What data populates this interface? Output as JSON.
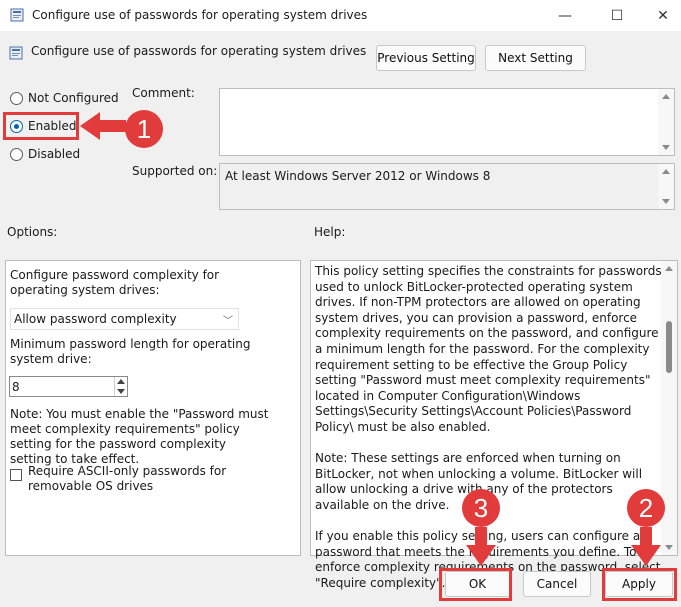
{
  "window": {
    "title": "Configure use of passwords for operating system drives",
    "controls": {
      "minimize": "—",
      "maximize": "☐",
      "close": "✕"
    }
  },
  "header": {
    "policy_title": "Configure use of passwords for operating system drives",
    "previous_label": "Previous Setting",
    "next_label": "Next Setting"
  },
  "state": {
    "options": [
      "Not Configured",
      "Enabled",
      "Disabled"
    ],
    "selected": "Enabled"
  },
  "comment": {
    "label": "Comment:",
    "value": ""
  },
  "supported": {
    "label": "Supported on:",
    "value": "At least Windows Server 2012 or Windows 8"
  },
  "options_section": {
    "label": "Options:",
    "complexity_label": "Configure password complexity for operating system  drives:",
    "complexity_value": "Allow password complexity",
    "min_length_label": "Minimum password length for operating system drive:",
    "min_length_value": "8",
    "note": "Note: You must enable the \"Password must meet complexity requirements\" policy setting for the password complexity setting to take effect.",
    "ascii_checkbox_label": "Require ASCII-only passwords for removable OS drives",
    "ascii_checked": false
  },
  "help_section": {
    "label": "Help:",
    "paragraphs": [
      "This policy setting specifies the constraints for passwords used to unlock BitLocker-protected operating system drives. If non-TPM protectors are allowed on operating system drives, you can provision a password, enforce complexity requirements on the password, and configure a minimum length for the password. For the complexity requirement setting to be effective the Group Policy setting \"Password must meet complexity requirements\" located in Computer Configuration\\Windows Settings\\Security Settings\\Account Policies\\Password Policy\\ must be also enabled.",
      "Note: These settings are enforced when turning on BitLocker, not when unlocking a volume. BitLocker will allow unlocking a drive with any of the protectors available on the drive.",
      "If you enable this policy setting, users can configure a password that meets the requirements you define. To enforce complexity requirements on the password, select \"Require complexity\"."
    ]
  },
  "footer": {
    "ok_label": "OK",
    "cancel_label": "Cancel",
    "apply_label": "Apply"
  },
  "annotations": {
    "step1": "1",
    "step2": "2",
    "step3": "3",
    "color": "#e23b3b"
  }
}
